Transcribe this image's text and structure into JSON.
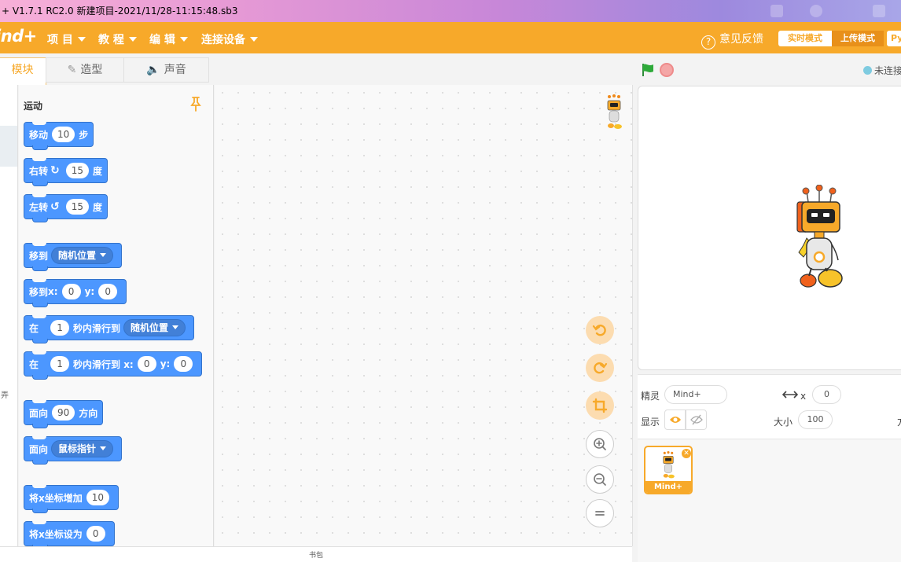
{
  "window": {
    "title": "+ V1.7.1 RC2.0   新建项目-2021/11/28-11:15:48.sb3"
  },
  "menubar": {
    "logo": "ind+",
    "menus": [
      {
        "label": "项 目"
      },
      {
        "label": "教 程"
      },
      {
        "label": "编 辑"
      },
      {
        "label": "连接设备"
      }
    ],
    "feedback": "意见反馈",
    "mode_realtime": "实时模式",
    "mode_upload": "上传模式",
    "mode_py": "Py"
  },
  "tabs": {
    "blocks": "模块",
    "costumes": "造型",
    "sounds": "声音"
  },
  "categories": {
    "cut_label": "弄"
  },
  "palette": {
    "section_title": "运动",
    "blocks": {
      "move": {
        "label": "移动",
        "value": "10",
        "suffix": "步"
      },
      "turn_right": {
        "label": "右转",
        "value": "15",
        "suffix": "度"
      },
      "turn_left": {
        "label": "左转",
        "value": "15",
        "suffix": "度"
      },
      "goto": {
        "label": "移到",
        "option": "随机位置"
      },
      "goto_xy": {
        "label": "移到",
        "x_label": "x:",
        "x": "0",
        "y_label": "y:",
        "y": "0"
      },
      "glide": {
        "label": "在",
        "secs": "1",
        "mid": "秒内滑行到",
        "option": "随机位置"
      },
      "glide_xy": {
        "label": "在",
        "secs": "1",
        "mid": "秒内滑行到 x:",
        "x": "0",
        "y_label": "y:",
        "y": "0"
      },
      "point_dir": {
        "label": "面向",
        "value": "90",
        "suffix": "方向"
      },
      "point_towards": {
        "label": "面向",
        "option": "鼠标指针"
      },
      "change_x": {
        "label": "将x坐标增加",
        "value": "10"
      },
      "set_x": {
        "label": "将x坐标设为",
        "value": "0"
      }
    }
  },
  "backpack": {
    "label": "书包"
  },
  "stage": {
    "status": "未连接"
  },
  "sprite_info": {
    "sprite_label": "精灵",
    "sprite_name": "Mind+",
    "x_label": "x",
    "x_value": "0",
    "show_label": "显示",
    "size_label": "大小",
    "size_value": "100",
    "dir_cut": "方"
  },
  "sprites": [
    {
      "name": "Mind+"
    }
  ],
  "colors": {
    "accent": "#f7a92a",
    "block_motion": "#4c97ff",
    "stop": "#f4a6a6",
    "flag": "#2eaa3a"
  }
}
